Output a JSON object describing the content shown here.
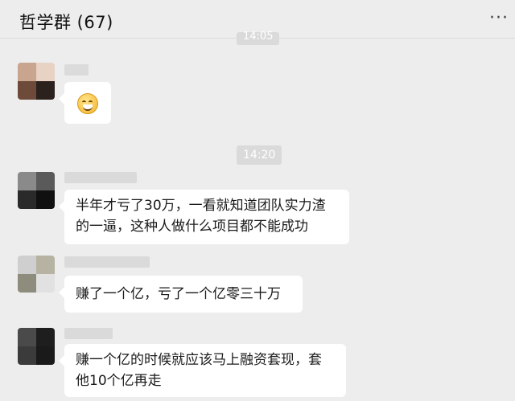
{
  "header": {
    "title": "哲学群 (67)",
    "more_icon": "more-dots-icon"
  },
  "timestamps": {
    "top_partial": "14:05",
    "mid": "14:20"
  },
  "messages": [
    {
      "kind": "emoji",
      "emoji_icon": "grinning-face-icon"
    },
    {
      "kind": "text",
      "text_line1": "半年才亏了30万，一看就知道团队实力渣",
      "text_line2": "的一逼，这种人做什么项目都不能成功"
    },
    {
      "kind": "text",
      "text_line1": "赚了一个亿，亏了一个亿零三十万"
    },
    {
      "kind": "text",
      "text_line1": "赚一个亿的时候就应该马上融资套现，套",
      "text_line2": "他10个亿再走"
    }
  ]
}
